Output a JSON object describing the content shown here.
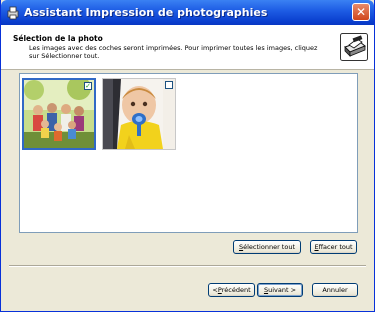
{
  "window": {
    "title": "Assistant Impression de photographies",
    "close_glyph": "✕"
  },
  "header": {
    "title": "Sélection de la photo",
    "subtitle": "Les images avec des coches seront imprimées. Pour imprimer toutes les images, cliquez sur Sélectionner tout.",
    "icon": "printer-icon"
  },
  "photos": [
    {
      "name": "family-group-photo",
      "checked": true,
      "selected": true
    },
    {
      "name": "child-with-pacifier-photo",
      "checked": false,
      "selected": false
    }
  ],
  "check_glyph": "✓",
  "actions": {
    "select_all": {
      "prefix": "",
      "accel": "S",
      "rest": "électionner tout"
    },
    "clear_all": {
      "prefix": "",
      "accel": "E",
      "rest": "ffacer tout"
    }
  },
  "nav": {
    "back": {
      "prefix": "< ",
      "accel": "P",
      "rest": "récédent"
    },
    "next": {
      "prefix": "",
      "accel": "S",
      "rest": "uivant >"
    },
    "cancel": {
      "label": "Annuler"
    }
  },
  "colors": {
    "titlebar": "#0a3fcf",
    "selection_border": "#3169c6",
    "dialog_bg": "#ece9d8"
  }
}
